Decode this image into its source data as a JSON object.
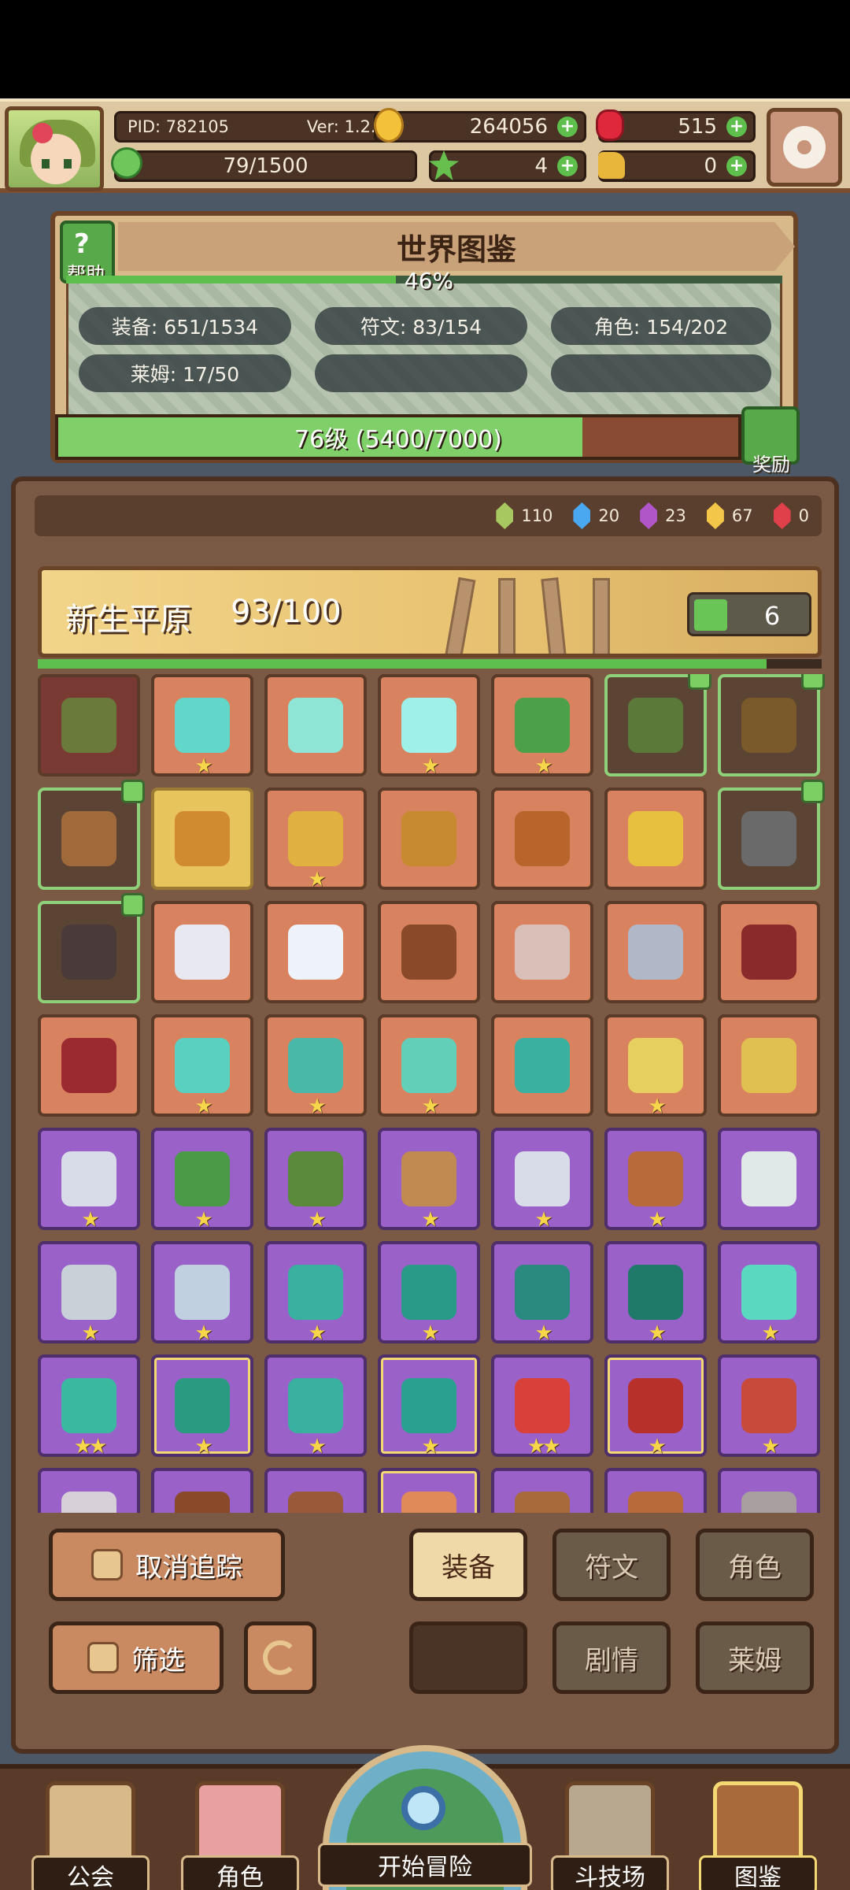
{
  "header": {
    "pid": "PID: 782105",
    "version": "Ver: 1.2.2.2",
    "gold": "264056",
    "gems": "515",
    "energy": "79/1500",
    "clover": "4",
    "tickets": "0"
  },
  "atlas": {
    "title": "世界图鉴",
    "help_label": "帮助",
    "completion_pct": "46%",
    "completion_value": 0.46,
    "stats": {
      "equipment": "装备: 651/1534",
      "runes": "符文: 83/154",
      "characters": "角色: 154/202",
      "slimes": "莱姆: 17/50"
    },
    "level_text": "76级 (5400/7000)",
    "level_progress": 0.771,
    "reward_label": "奖励"
  },
  "essences": [
    {
      "count": "110",
      "color": "#a7c860"
    },
    {
      "count": "20",
      "color": "#4aa8f0"
    },
    {
      "count": "23",
      "color": "#b056c8"
    },
    {
      "count": "67",
      "color": "#f3c64a"
    },
    {
      "count": "0",
      "color": "#e0404a"
    }
  ],
  "region": {
    "name": "新生平原",
    "count": "93/100",
    "progress": 0.93,
    "likes": "6"
  },
  "items": [
    {
      "icon": "straw-hat-icon",
      "rarity": "r-dark",
      "stars": "",
      "thumb": false,
      "color": "#6a7a3a"
    },
    {
      "icon": "staff-icon",
      "rarity": "r-orange",
      "stars": "★",
      "thumb": false,
      "color": "#62d6c8"
    },
    {
      "icon": "orb-icon",
      "rarity": "r-orange",
      "stars": "",
      "thumb": false,
      "color": "#8fe6d6"
    },
    {
      "icon": "crystal-icon",
      "rarity": "r-orange",
      "stars": "★",
      "thumb": false,
      "color": "#9ff0e8"
    },
    {
      "icon": "hood-icon",
      "rarity": "r-orange",
      "stars": "★",
      "thumb": false,
      "color": "#4da04a"
    },
    {
      "icon": "armor-icon",
      "rarity": "r-green",
      "stars": "",
      "thumb": true,
      "color": "#5b7a3a"
    },
    {
      "icon": "ring-icon",
      "rarity": "r-green",
      "stars": "",
      "thumb": true,
      "color": "#7a5a2a"
    },
    {
      "icon": "crossbow-icon",
      "rarity": "r-green",
      "stars": "",
      "thumb": true,
      "color": "#a06a3a"
    },
    {
      "icon": "spear-icon",
      "rarity": "r-gold",
      "stars": "",
      "thumb": false,
      "color": "#d08a30"
    },
    {
      "icon": "necklace-icon",
      "rarity": "r-orange",
      "stars": "★",
      "thumb": false,
      "color": "#e0b040"
    },
    {
      "icon": "sword-hilt-icon",
      "rarity": "r-orange",
      "stars": "",
      "thumb": false,
      "color": "#c88a30"
    },
    {
      "icon": "bracelet-icon",
      "rarity": "r-orange",
      "stars": "",
      "thumb": false,
      "color": "#b8642a"
    },
    {
      "icon": "gem-ring-icon",
      "rarity": "r-orange",
      "stars": "",
      "thumb": false,
      "color": "#e8c040"
    },
    {
      "icon": "axe-icon",
      "rarity": "r-green",
      "stars": "",
      "thumb": true,
      "color": "#6a6a6a"
    },
    {
      "icon": "dark-helmet-icon",
      "rarity": "r-green",
      "stars": "",
      "thumb": true,
      "color": "#4a3a3a"
    },
    {
      "icon": "potion-icon",
      "rarity": "r-orange",
      "stars": "",
      "thumb": false,
      "color": "#e8e8f0"
    },
    {
      "icon": "pearl-icon",
      "rarity": "r-orange",
      "stars": "",
      "thumb": false,
      "color": "#eef2fa"
    },
    {
      "icon": "gauntlet-icon",
      "rarity": "r-orange",
      "stars": "",
      "thumb": false,
      "color": "#8a4a2a"
    },
    {
      "icon": "heart-amulet-icon",
      "rarity": "r-orange",
      "stars": "",
      "thumb": false,
      "color": "#d8c0b8"
    },
    {
      "icon": "dagger-icon",
      "rarity": "r-orange",
      "stars": "",
      "thumb": false,
      "color": "#b0b8c8"
    },
    {
      "icon": "red-hood-icon",
      "rarity": "r-orange",
      "stars": "",
      "thumb": false,
      "color": "#8a2a2a"
    },
    {
      "icon": "red-cape-icon",
      "rarity": "r-orange",
      "stars": "",
      "thumb": false,
      "color": "#9a2a30"
    },
    {
      "icon": "bow-icon",
      "rarity": "r-orange",
      "stars": "★",
      "thumb": false,
      "color": "#5ad0c0"
    },
    {
      "icon": "arrow-staff-icon",
      "rarity": "r-orange",
      "stars": "★",
      "thumb": false,
      "color": "#4ab8a8"
    },
    {
      "icon": "boots-icon",
      "rarity": "r-orange",
      "stars": "★",
      "thumb": false,
      "color": "#62d0b8"
    },
    {
      "icon": "teal-helmet-icon",
      "rarity": "r-orange",
      "stars": "",
      "thumb": false,
      "color": "#3ab0a0"
    },
    {
      "icon": "glove-icon",
      "rarity": "r-orange",
      "stars": "★",
      "thumb": false,
      "color": "#e8d060"
    },
    {
      "icon": "crown-helmet-icon",
      "rarity": "r-orange",
      "stars": "",
      "thumb": false,
      "color": "#e0c050"
    },
    {
      "icon": "sword-icon",
      "rarity": "r-purple",
      "stars": "★",
      "thumb": false,
      "color": "#d8dce8"
    },
    {
      "icon": "green-hood-icon",
      "rarity": "r-purple",
      "stars": "★",
      "thumb": false,
      "color": "#4a9a48"
    },
    {
      "icon": "green-armor-icon",
      "rarity": "r-purple",
      "stars": "★",
      "thumb": false,
      "color": "#5a8a3a"
    },
    {
      "icon": "purple-bow-icon",
      "rarity": "r-purple",
      "stars": "★",
      "thumb": false,
      "color": "#c08a50"
    },
    {
      "icon": "lance-icon",
      "rarity": "r-purple",
      "stars": "★",
      "thumb": false,
      "color": "#d8dce8"
    },
    {
      "icon": "leather-boots-icon",
      "rarity": "r-purple",
      "stars": "★",
      "thumb": false,
      "color": "#b86a3a"
    },
    {
      "icon": "white-armor-icon",
      "rarity": "r-purple",
      "stars": "",
      "thumb": false,
      "color": "#e0e8e8"
    },
    {
      "icon": "belt-icon",
      "rarity": "r-purple",
      "stars": "★",
      "thumb": false,
      "color": "#c8d0d8"
    },
    {
      "icon": "plate-boots-icon",
      "rarity": "r-purple",
      "stars": "★",
      "thumb": false,
      "color": "#c0d0e0"
    },
    {
      "icon": "mace-icon",
      "rarity": "r-purple",
      "stars": "★",
      "thumb": false,
      "color": "#3ab0a0"
    },
    {
      "icon": "witch-hat-icon",
      "rarity": "r-purple",
      "stars": "★",
      "thumb": false,
      "color": "#2a9a88"
    },
    {
      "icon": "teal-armor-icon",
      "rarity": "r-purple",
      "stars": "★",
      "thumb": false,
      "color": "#2a8a80"
    },
    {
      "icon": "bracer-icon",
      "rarity": "r-purple",
      "stars": "★",
      "thumb": false,
      "color": "#1f7a6a"
    },
    {
      "icon": "jade-ring-icon",
      "rarity": "r-purple",
      "stars": "★",
      "thumb": false,
      "color": "#5ad8c0"
    },
    {
      "icon": "jade-boots-icon",
      "rarity": "r-purple",
      "stars": "★★",
      "thumb": false,
      "color": "#3ab8a0"
    },
    {
      "icon": "emerald-icon",
      "rarity": "r-purple",
      "stars": "★",
      "thumb": false,
      "color": "#2a9a80",
      "framed": true
    },
    {
      "icon": "jade-necklace-icon",
      "rarity": "r-purple",
      "stars": "★",
      "thumb": false,
      "color": "#3ab0a0"
    },
    {
      "icon": "jade-pendant-icon",
      "rarity": "r-purple",
      "stars": "★",
      "thumb": false,
      "color": "#2aa090",
      "framed": true
    },
    {
      "icon": "red-slime-icon",
      "rarity": "r-purple",
      "stars": "★★",
      "thumb": false,
      "color": "#d8403a"
    },
    {
      "icon": "red-robe-icon",
      "rarity": "r-purple",
      "stars": "★",
      "thumb": false,
      "color": "#b8302a",
      "framed": true
    },
    {
      "icon": "red-boots-icon",
      "rarity": "r-purple",
      "stars": "★",
      "thumb": false,
      "color": "#c84a3a"
    },
    {
      "icon": "silver-wing-icon",
      "rarity": "r-purple",
      "stars": "",
      "thumb": false,
      "color": "#d8d0d8"
    },
    {
      "icon": "brown-hat-icon",
      "rarity": "r-purple",
      "stars": "",
      "thumb": false,
      "color": "#8a4a2a"
    },
    {
      "icon": "brown-ring-icon",
      "rarity": "r-purple",
      "stars": "",
      "thumb": false,
      "color": "#9a5a3a"
    },
    {
      "icon": "mushroom-icon",
      "rarity": "r-purple",
      "stars": "",
      "thumb": false,
      "color": "#e08a5a",
      "framed": true
    },
    {
      "icon": "horn-helmet-icon",
      "rarity": "r-purple",
      "stars": "",
      "thumb": false,
      "color": "#a86a3a"
    },
    {
      "icon": "leather-armor-icon",
      "rarity": "r-purple",
      "stars": "",
      "thumb": false,
      "color": "#b86a3a"
    },
    {
      "icon": "scythe-icon",
      "rarity": "r-purple",
      "stars": "",
      "thumb": false,
      "color": "#a8a0a0"
    }
  ],
  "controls": {
    "untrack": "取消追踪",
    "filter": "筛选",
    "tab_equipment": "装备",
    "tab_runes": "符文",
    "tab_characters": "角色",
    "tab_story": "剧情",
    "tab_slimes": "莱姆"
  },
  "nav": {
    "guild": "公会",
    "characters": "角色",
    "adventure": "开始冒险",
    "arena": "斗技场",
    "atlas": "图鉴"
  }
}
